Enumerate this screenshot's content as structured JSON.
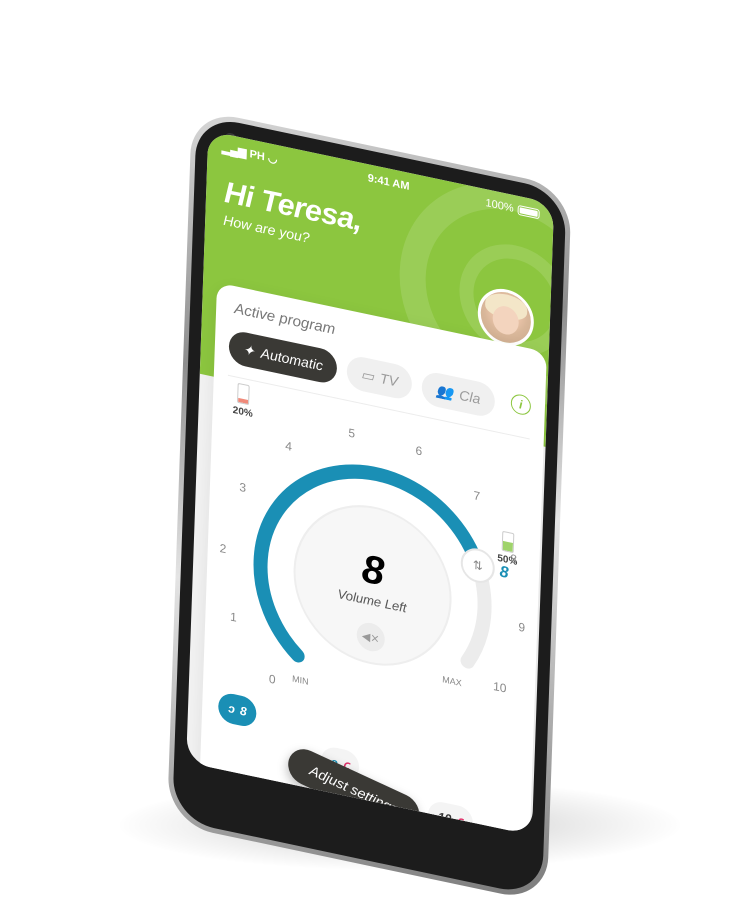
{
  "status_bar": {
    "carrier": "PH",
    "time": "9:41 AM",
    "battery": "100%"
  },
  "greeting": {
    "title": "Hi Teresa,",
    "subtitle": "How are you?"
  },
  "card": {
    "title": "Active program",
    "programs": [
      {
        "label": "Automatic",
        "icon": "magic-wand-icon",
        "active": true
      },
      {
        "label": "TV",
        "icon": "tv-icon",
        "active": false
      },
      {
        "label": "Cla",
        "icon": "group-icon",
        "active": false
      }
    ],
    "info_label": "i"
  },
  "battery_left": {
    "label": "20%",
    "level": 0.2,
    "color": "#f08a7a"
  },
  "battery_right": {
    "label": "50%",
    "level": 0.5,
    "color": "#9fd36b"
  },
  "volume": {
    "value_label": "8",
    "caption": "Volume Left",
    "ticks": [
      "0",
      "1",
      "2",
      "3",
      "4",
      "5",
      "6",
      "7",
      "8",
      "9",
      "10"
    ],
    "min_label": "MIN",
    "max_label": "MAX",
    "side_value": "8",
    "level": 0.8,
    "accent": "#1a8fb5"
  },
  "side_chips": {
    "left_value": "8",
    "right_value": "10"
  },
  "colors": {
    "brand_green": "#8cc63f",
    "dark": "#3a3935",
    "left_ear": "#1a8fb5",
    "right_ear": "#e0336b"
  },
  "actions": {
    "adjust_label": "Adjust settings"
  }
}
